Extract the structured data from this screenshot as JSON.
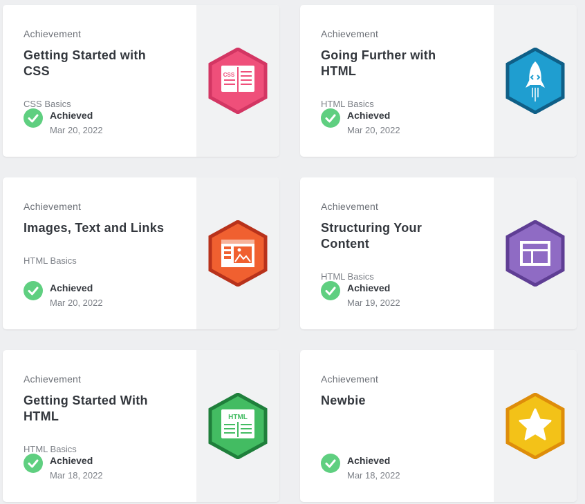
{
  "cards": [
    {
      "kicker": "Achievement",
      "title": "Getting Started with CSS",
      "subtitle": "CSS Basics",
      "status": "Achieved",
      "date": "Mar 20, 2022",
      "badge_icon": "css-book-icon",
      "badge_color": "#ef4f7a",
      "badge_border": "#d33663"
    },
    {
      "kicker": "Achievement",
      "title": "Going Further with HTML",
      "subtitle": "HTML Basics",
      "status": "Achieved",
      "date": "Mar 20, 2022",
      "badge_icon": "rocket-icon",
      "badge_color": "#1f9ed0",
      "badge_border": "#0f5f87"
    },
    {
      "kicker": "Achievement",
      "title": "Images, Text and Links",
      "subtitle": "HTML Basics",
      "status": "Achieved",
      "date": "Mar 20, 2022",
      "badge_icon": "image-page-icon",
      "badge_color": "#f06030",
      "badge_border": "#b8321b"
    },
    {
      "kicker": "Achievement",
      "title": "Structuring Your Content",
      "subtitle": "HTML Basics",
      "status": "Achieved",
      "date": "Mar 19, 2022",
      "badge_icon": "layout-icon",
      "badge_color": "#8f6bc4",
      "badge_border": "#5f3e94"
    },
    {
      "kicker": "Achievement",
      "title": "Getting Started With HTML",
      "subtitle": "HTML Basics",
      "status": "Achieved",
      "date": "Mar 18, 2022",
      "badge_icon": "html-book-icon",
      "badge_color": "#43bc62",
      "badge_border": "#1f7f3b"
    },
    {
      "kicker": "Achievement",
      "title": "Newbie",
      "subtitle": "",
      "status": "Achieved",
      "date": "Mar 18, 2022",
      "badge_icon": "star-icon",
      "badge_color": "#f3c218",
      "badge_border": "#de8d0a"
    }
  ],
  "colors": {
    "achieved": "#5fcf80",
    "page_background": "#eeeff1"
  }
}
